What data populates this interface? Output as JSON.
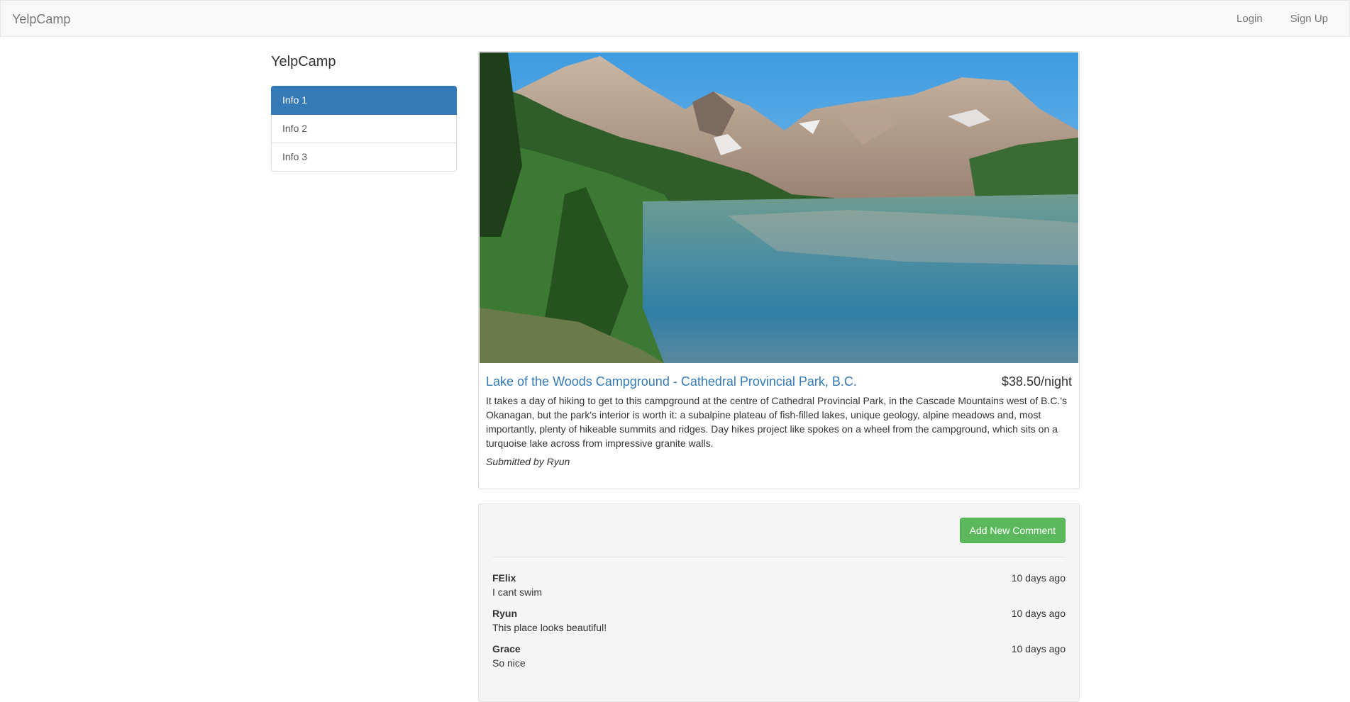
{
  "navbar": {
    "brand": "YelpCamp",
    "login": "Login",
    "signup": "Sign Up"
  },
  "sidebar": {
    "title": "YelpCamp",
    "items": [
      {
        "label": "Info 1",
        "active": true
      },
      {
        "label": "Info 2",
        "active": false
      },
      {
        "label": "Info 3",
        "active": false
      }
    ]
  },
  "campground": {
    "name": "Lake of the Woods Campground - Cathedral Provincial Park, B.C.",
    "price": "$38.50/night",
    "description_lines": [
      "It takes a day of hiking to get to this campground at the centre of Cathedral Provincial Park, in the Cascade Mountains west of B.C.'s",
      "Okanagan, but the park's interior is worth it: a subalpine plateau of fish-filled lakes, unique geology, alpine meadows and, most",
      "importantly, plenty of hikeable summits and ridges. Day hikes project like spokes on a wheel from the campground, which sits on a",
      "turquoise lake across from impressive granite walls."
    ],
    "submitted_by": "Submitted by Ryun"
  },
  "comments_section": {
    "add_button": "Add New Comment",
    "comments": [
      {
        "author": "FElix",
        "time": "10 days ago",
        "text": "I cant swim"
      },
      {
        "author": "Ryun",
        "time": "10 days ago",
        "text": "This place looks beautiful!"
      },
      {
        "author": "Grace",
        "time": "10 days ago",
        "text": "So nice"
      }
    ]
  },
  "colors": {
    "primary": "#337ab7",
    "success": "#5cb85c",
    "navbar_bg": "#f8f8f8",
    "well_bg": "#f5f5f5"
  }
}
